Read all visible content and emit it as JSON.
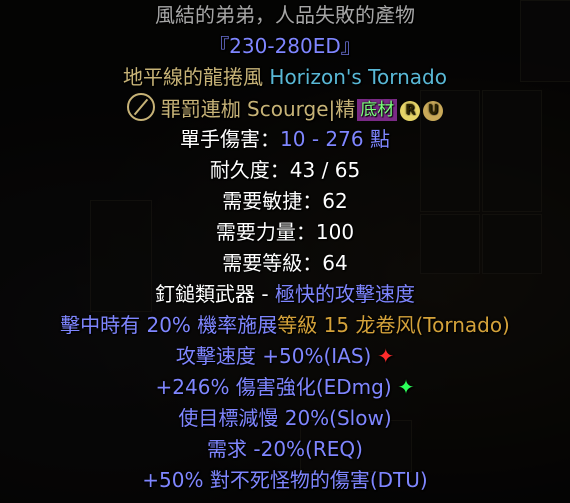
{
  "header": {
    "flavor": "風結的弟弟，人品失敗的產物",
    "damage_tag": "『230-280ED』",
    "name_cn": "地平線的龍捲風",
    "name_en": "Horizon's Tornado",
    "base_name": "罪罰連枷 Scourge",
    "base_sep": "|",
    "base_quality": "精",
    "base_badge": "底材",
    "badge_r": "R",
    "badge_u": "U"
  },
  "stats": {
    "one_hand_label": "單手傷害：",
    "one_hand_value": "10 - 276 點",
    "durability": "耐久度：43 / 65",
    "req_dex": "需要敏捷：62",
    "req_str": "需要力量：100",
    "req_level": "需要等級：64",
    "weapon_class": "釘鎚類武器 - ",
    "attack_speed": "極快的攻擊速度"
  },
  "mods": {
    "proc_prefix": "擊中時有 20% 機率施展",
    "proc_skill": "等級 15 龙卷风(Tornado)",
    "ias": "攻擊速度 +50%(IAS)",
    "edmg": "+246% 傷害強化(EDmg)",
    "slow": "使目標減慢 20%(Slow)",
    "req": "需求 -20%(REQ)",
    "dtu": "+50% 對不死怪物的傷害(DTU)"
  },
  "markers": {
    "ias_star": "✦",
    "edmg_star": "✦"
  },
  "colors": {
    "unique_gold": "#c7b377",
    "magic_blue": "#7f86ff",
    "set_orange": "#d4a23a",
    "cyan": "#59b8d6",
    "star_red": "#ff2c2c",
    "star_green": "#2cff5a"
  }
}
